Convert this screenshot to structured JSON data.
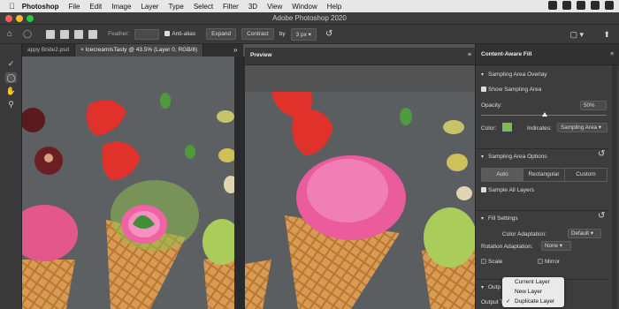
{
  "menubar": {
    "app": "Photoshop",
    "items": [
      "File",
      "Edit",
      "Image",
      "Layer",
      "Type",
      "Select",
      "Filter",
      "3D",
      "View",
      "Window",
      "Help"
    ]
  },
  "window": {
    "title": "Adobe Photoshop 2020"
  },
  "options": {
    "feather_label": "Feather:",
    "anti_alias": "Anti-alias",
    "expand": "Expand",
    "contract": "Contract",
    "by": "by",
    "by_value": "3 px"
  },
  "tabs": [
    {
      "label": "appy Bride2.psd"
    },
    {
      "label": "IcecreamIsTasty @ 43.5% (Layer 0, RGB/8)"
    }
  ],
  "preview": {
    "title": "Preview"
  },
  "panel": {
    "title": "Content-Aware Fill",
    "sampling_overlay": "Sampling Area Overlay",
    "show_sampling": "Show Sampling Area",
    "opacity_label": "Opacity:",
    "opacity_value": "50%",
    "color_label": "Color:",
    "indicates_label": "Indicates:",
    "indicates_value": "Sampling Area",
    "sampling_options": "Sampling Area Options",
    "seg": [
      "Auto",
      "Rectangular",
      "Custom"
    ],
    "sample_all": "Sample All Layers",
    "fill_settings": "Fill Settings",
    "color_adapt_label": "Color Adaptation:",
    "color_adapt_value": "Default",
    "rotation_label": "Rotation Adaptation:",
    "rotation_value": "None",
    "scale": "Scale",
    "mirror": "Mirror",
    "output_section": "Outp",
    "output_to": "Output T"
  },
  "popup": {
    "items": [
      "Current Layer",
      "New Layer",
      "Duplicate Layer"
    ],
    "checked_mark": "✓"
  },
  "colors": {
    "overlay": "#7ac043",
    "accent": "#2d8cff"
  }
}
